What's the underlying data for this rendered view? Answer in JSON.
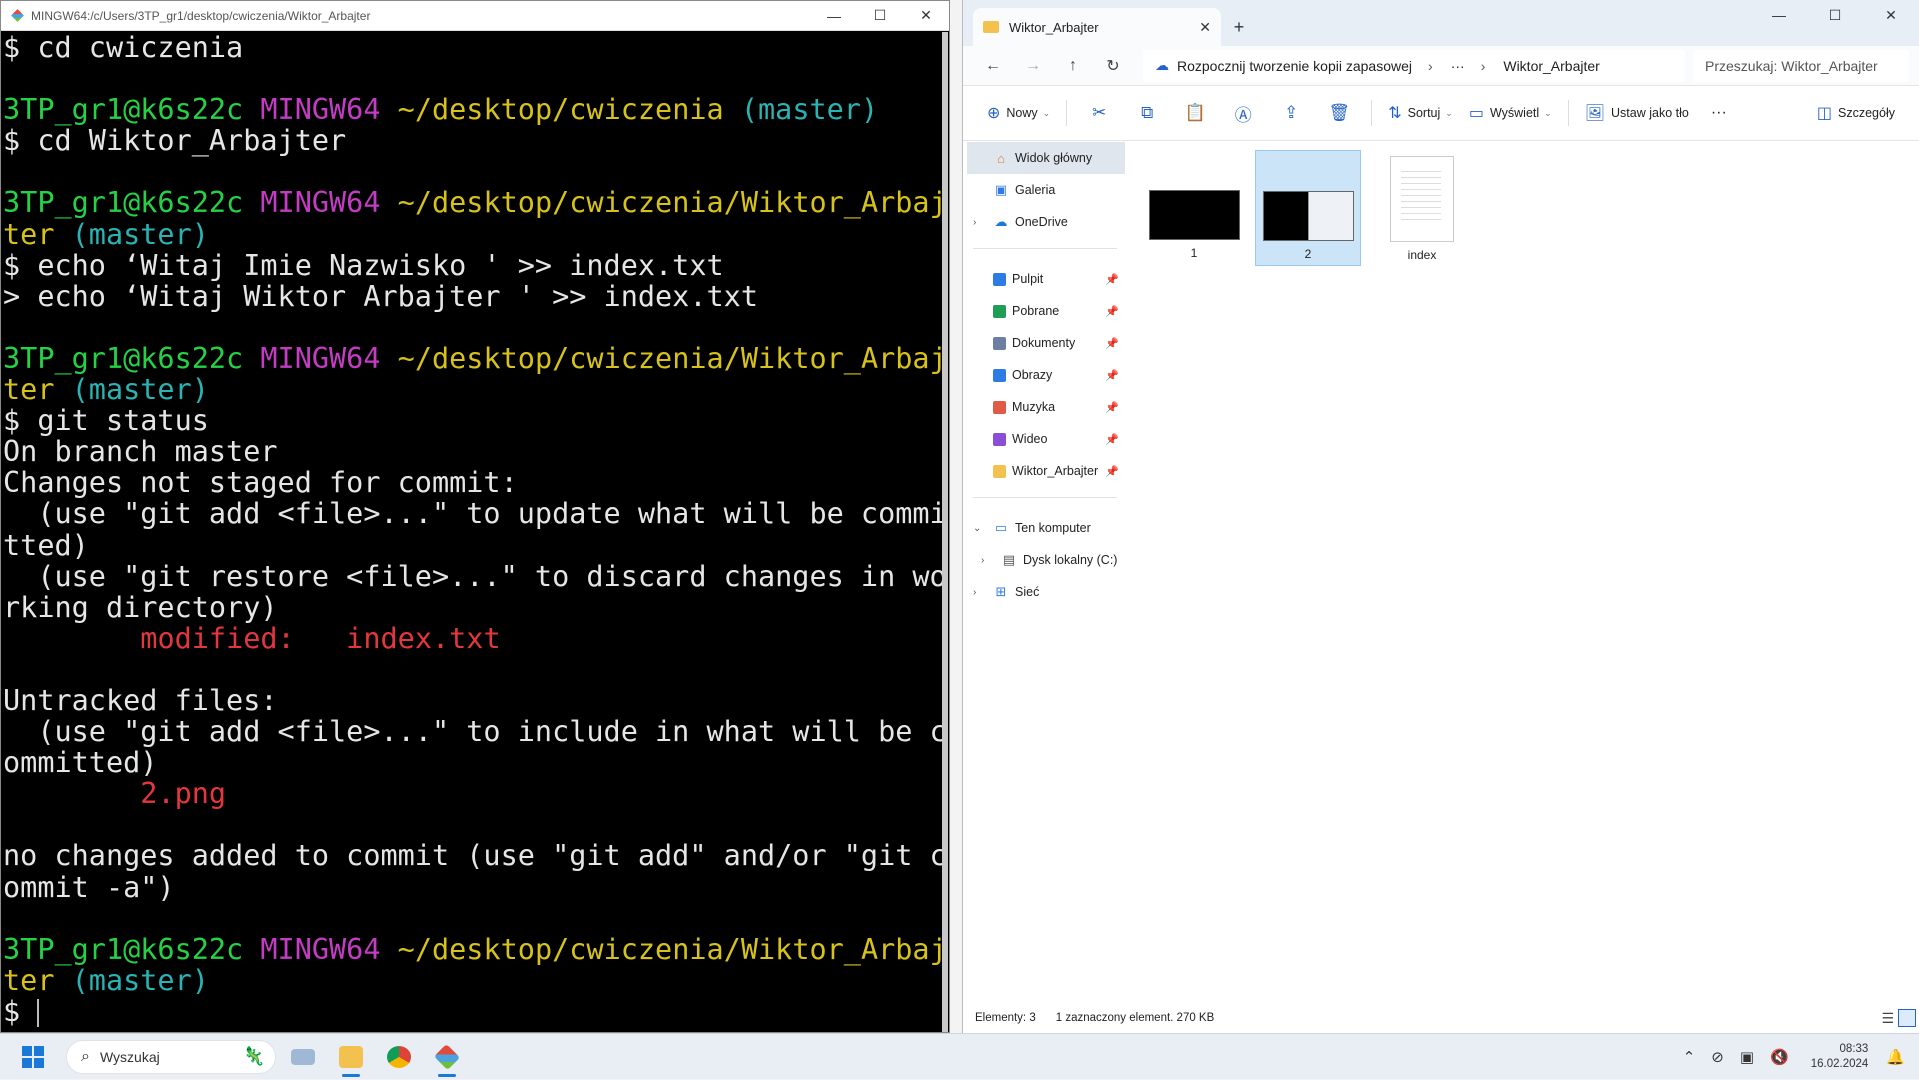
{
  "terminal": {
    "title": "MINGW64:/c/Users/3TP_gr1/desktop/cwiczenia/Wiktor_Arbajter",
    "lines": [
      [
        {
          "t": "$ cd cwiczenia",
          "c": "w"
        }
      ],
      [
        {
          "t": "",
          "c": "w"
        }
      ],
      [
        {
          "t": "3TP_gr1@k6s22c ",
          "c": "g"
        },
        {
          "t": "MINGW64 ",
          "c": "m"
        },
        {
          "t": "~/desktop/cwiczenia ",
          "c": "y"
        },
        {
          "t": "(master)",
          "c": "c"
        }
      ],
      [
        {
          "t": "$ cd Wiktor_Arbajter",
          "c": "w"
        }
      ],
      [
        {
          "t": "",
          "c": "w"
        }
      ],
      [
        {
          "t": "3TP_gr1@k6s22c ",
          "c": "g"
        },
        {
          "t": "MINGW64 ",
          "c": "m"
        },
        {
          "t": "~/desktop/cwiczenia/Wiktor_Arbaj",
          "c": "y"
        }
      ],
      [
        {
          "t": "ter ",
          "c": "y"
        },
        {
          "t": "(master)",
          "c": "c"
        }
      ],
      [
        {
          "t": "$ echo ‘Witaj Imie Nazwisko ' >> index.txt",
          "c": "w"
        }
      ],
      [
        {
          "t": "> echo ‘Witaj Wiktor Arbajter ' >> index.txt",
          "c": "w"
        }
      ],
      [
        {
          "t": "",
          "c": "w"
        }
      ],
      [
        {
          "t": "3TP_gr1@k6s22c ",
          "c": "g"
        },
        {
          "t": "MINGW64 ",
          "c": "m"
        },
        {
          "t": "~/desktop/cwiczenia/Wiktor_Arbaj",
          "c": "y"
        }
      ],
      [
        {
          "t": "ter ",
          "c": "y"
        },
        {
          "t": "(master)",
          "c": "c"
        }
      ],
      [
        {
          "t": "$ git status",
          "c": "w"
        }
      ],
      [
        {
          "t": "On branch master",
          "c": "w"
        }
      ],
      [
        {
          "t": "Changes not staged for commit:",
          "c": "w"
        }
      ],
      [
        {
          "t": "  (use \"git add <file>...\" to update what will be commi",
          "c": "w"
        }
      ],
      [
        {
          "t": "tted)",
          "c": "w"
        }
      ],
      [
        {
          "t": "  (use \"git restore <file>...\" to discard changes in wo",
          "c": "w"
        }
      ],
      [
        {
          "t": "rking directory)",
          "c": "w"
        }
      ],
      [
        {
          "t": "        ",
          "c": "w"
        },
        {
          "t": "modified:   index.txt",
          "c": "r"
        }
      ],
      [
        {
          "t": "",
          "c": "w"
        }
      ],
      [
        {
          "t": "Untracked files:",
          "c": "w"
        }
      ],
      [
        {
          "t": "  (use \"git add <file>...\" to include in what will be c",
          "c": "w"
        }
      ],
      [
        {
          "t": "ommitted)",
          "c": "w"
        }
      ],
      [
        {
          "t": "        ",
          "c": "w"
        },
        {
          "t": "2.png",
          "c": "r"
        }
      ],
      [
        {
          "t": "",
          "c": "w"
        }
      ],
      [
        {
          "t": "no changes added to commit (use \"git add\" and/or \"git c",
          "c": "w"
        }
      ],
      [
        {
          "t": "ommit -a\")",
          "c": "w"
        }
      ],
      [
        {
          "t": "",
          "c": "w"
        }
      ],
      [
        {
          "t": "3TP_gr1@k6s22c ",
          "c": "g"
        },
        {
          "t": "MINGW64 ",
          "c": "m"
        },
        {
          "t": "~/desktop/cwiczenia/Wiktor_Arbaj",
          "c": "y"
        }
      ],
      [
        {
          "t": "ter ",
          "c": "y"
        },
        {
          "t": "(master)",
          "c": "c"
        }
      ],
      [
        {
          "t": "$ ",
          "c": "w"
        }
      ]
    ]
  },
  "explorer": {
    "tab_title": "Wiktor_Arbajter",
    "address": {
      "backup_label": "Rozpocznij tworzenie kopii zapasowej",
      "ellipsis": "···",
      "current": "Wiktor_Arbajter"
    },
    "search_placeholder": "Przeszukaj: Wiktor_Arbajter",
    "toolbar": {
      "new_label": "Nowy",
      "sort_label": "Sortuj",
      "view_label": "Wyświetl",
      "set_bg_label": "Ustaw jako tło",
      "more_label": "···",
      "details_label": "Szczegóły"
    },
    "nav": {
      "home": "Widok główny",
      "gallery": "Galeria",
      "onedrive": "OneDrive",
      "quick": [
        {
          "label": "Pulpit",
          "icon": "desktop-icon",
          "color": "#2f7be6"
        },
        {
          "label": "Pobrane",
          "icon": "download-icon",
          "color": "#1f9d55"
        },
        {
          "label": "Dokumenty",
          "icon": "documents-icon",
          "color": "#6b7fa3"
        },
        {
          "label": "Obrazy",
          "icon": "pictures-icon",
          "color": "#2f7be6"
        },
        {
          "label": "Muzyka",
          "icon": "music-icon",
          "color": "#e05a47"
        },
        {
          "label": "Wideo",
          "icon": "video-icon",
          "color": "#8a4fd6"
        },
        {
          "label": "Wiktor_Arbajter",
          "icon": "folder-icon",
          "color": "#f2c14e"
        }
      ],
      "this_pc": "Ten komputer",
      "local_disk": "Dysk lokalny (C:)",
      "network": "Sieć"
    },
    "files": [
      {
        "name": "1",
        "type": "image-dark"
      },
      {
        "name": "2",
        "type": "image-split",
        "selected": true
      },
      {
        "name": "index",
        "type": "text"
      }
    ],
    "status": {
      "count": "Elementy: 3",
      "selection": "1 zaznaczony element. 270 KB"
    }
  },
  "taskbar": {
    "search_label": "Wyszukaj",
    "time": "08:33",
    "date": "16.02.2024"
  }
}
